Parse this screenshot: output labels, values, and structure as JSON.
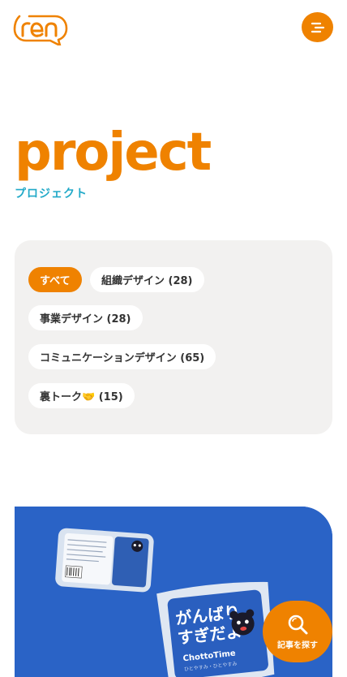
{
  "header": {
    "logo_text": "ren",
    "menu_icon": "hamburger-menu-icon"
  },
  "hero": {
    "title": "project",
    "subtitle": "プロジェクト"
  },
  "filters": {
    "categories": [
      {
        "label": "すべて",
        "active": true
      },
      {
        "label": "組織デザイン (28)",
        "active": false
      },
      {
        "label": "事業デザイン (28)",
        "active": false
      },
      {
        "label": "コミュニケーションデザイン (65)",
        "active": false
      },
      {
        "label": "裏トーク🤝 (15)",
        "active": false
      }
    ]
  },
  "card": {
    "image_text_front": "がんばりすぎだよ",
    "image_brand": "ChottoTime",
    "image_brand_sub": "ひとやすみ・ひとやすみ"
  },
  "search_fab": {
    "label": "記事を探す",
    "icon": "magnifier-icon"
  },
  "colors": {
    "accent": "#ef8200",
    "subtitle": "#21a9c8",
    "panel": "#f2f1f0",
    "card_bg": "#2a63c6"
  }
}
